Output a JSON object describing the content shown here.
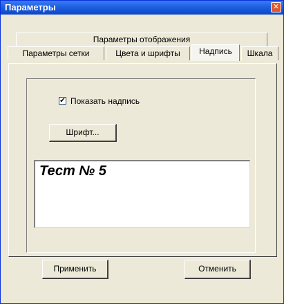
{
  "window": {
    "title": "Параметры",
    "close_glyph": "✕"
  },
  "tabs": {
    "row1": [
      {
        "label": "Параметры отображения"
      }
    ],
    "row2": [
      {
        "label": "Параметры сетки"
      },
      {
        "label": "Цвета и шрифты"
      },
      {
        "label": "Надпись",
        "active": true
      },
      {
        "label": "Шкала"
      }
    ]
  },
  "panel": {
    "show_caption_checkbox": {
      "label": "Показать надпись",
      "checked": true,
      "mark": "✔"
    },
    "font_button": "Шрифт...",
    "preview_text": "Тест № 5"
  },
  "footer": {
    "apply_button": "Применить",
    "cancel_button": "Отменить"
  },
  "colors": {
    "title_bar": "#1e5fe0",
    "dialog_bg": "#ece9d8",
    "close_button": "#e2542c"
  }
}
